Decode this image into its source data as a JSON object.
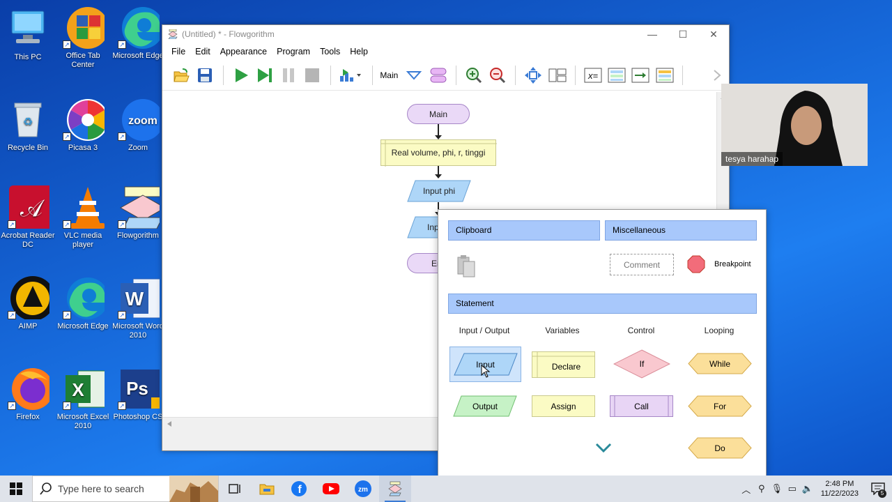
{
  "desktop": {
    "icons": [
      {
        "label": "This PC"
      },
      {
        "label": "Office Tab Center"
      },
      {
        "label": "Microsoft Edge"
      },
      {
        "label": "Recycle Bin"
      },
      {
        "label": "Picasa 3"
      },
      {
        "label": "Zoom"
      },
      {
        "label": "Acrobat Reader DC"
      },
      {
        "label": "VLC media player"
      },
      {
        "label": "Flowgorithm"
      },
      {
        "label": "AIMP"
      },
      {
        "label": "Microsoft Edge"
      },
      {
        "label": "Microsoft Word 2010"
      },
      {
        "label": "Firefox"
      },
      {
        "label": "Microsoft Excel 2010"
      },
      {
        "label": "Photoshop CS"
      }
    ]
  },
  "window": {
    "title": "(Untitled) * - Flowgorithm",
    "menu": [
      "File",
      "Edit",
      "Appearance",
      "Program",
      "Tools",
      "Help"
    ],
    "toolbar": {
      "function_select": "Main",
      "icons": [
        "open-icon",
        "save-icon",
        "run-icon",
        "step-icon",
        "pause-icon",
        "stop-icon",
        "run-speed-icon",
        "function-dropdown-icon",
        "function-manager-icon",
        "zoom-in-icon",
        "zoom-out-icon",
        "layout-icon",
        "chart-view-icon",
        "variable-watch-icon",
        "console-icon",
        "source-viewer-icon",
        "print-icon"
      ]
    }
  },
  "flowchart": {
    "start": "Main",
    "declare": "Real volume, phi, r, tinggi",
    "input1": "Input phi",
    "input2": "Inp",
    "end": "En"
  },
  "popup": {
    "clipboard_header": "Clipboard",
    "misc_header": "Miscellaneous",
    "comment": "Comment",
    "breakpoint": "Breakpoint",
    "statement_header": "Statement",
    "columns": [
      "Input / Output",
      "Variables",
      "Control",
      "Looping"
    ],
    "shapes": {
      "input": "Input",
      "output": "Output",
      "declare": "Declare",
      "assign": "Assign",
      "if": "If",
      "call": "Call",
      "while": "While",
      "for": "For",
      "do": "Do"
    },
    "colors": {
      "header": "#a8c8fb",
      "io": "#aed6f8",
      "output": "#c6f2c6",
      "variables": "#fbfbc4",
      "control": "#f9c8cf",
      "call": "#e8d5f5",
      "looping": "#fbdf9a",
      "breakpoint": "#f26c7a"
    }
  },
  "webcam": {
    "name": "tesya harahap"
  },
  "taskbar": {
    "search_placeholder": "Type here to search",
    "time": "2:48 PM",
    "date": "11/22/2023",
    "notification_count": "5"
  }
}
